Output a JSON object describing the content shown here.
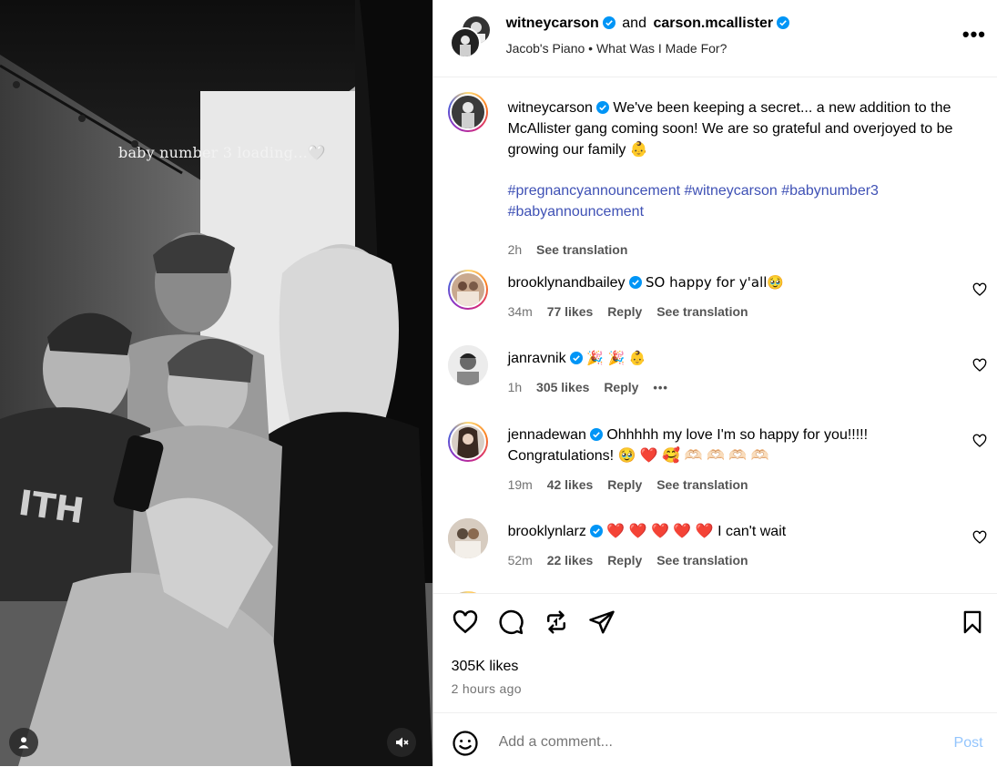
{
  "media": {
    "overlay_text": "baby number 3 loading...🤍"
  },
  "header": {
    "user1": "witneycarson",
    "and_word": "and",
    "user2": "carson.mcallister",
    "audio": "Jacob's Piano • What Was I Made For?",
    "more_label": "•••"
  },
  "caption": {
    "username": "witneycarson",
    "text": "We've been keeping a secret... a new addition to the McAllister gang coming soon! We are so grateful and overjoyed to be growing our family 👶",
    "hashtags_line1": "#pregnancyannouncement #witneycarson #babynumber3",
    "hashtags_line2": "#babyannouncement",
    "time": "2h",
    "see_translation": "See translation"
  },
  "comments": [
    {
      "username": "brooklynandbailey",
      "text": "SO happy for y'all🥹",
      "time": "34m",
      "likes": "77 likes",
      "reply": "Reply",
      "translate": "See translation"
    },
    {
      "username": "janravnik",
      "text": "🎉 🎉 👶",
      "time": "1h",
      "likes": "305 likes",
      "reply": "Reply",
      "more": "•••"
    },
    {
      "username": "jennadewan",
      "text": "Ohhhhh my love I'm so happy for you!!!!! Congratulations! 🥹 ❤️ 🥰 🫶🏻 🫶🏻 🫶🏻 🫶🏻",
      "time": "19m",
      "likes": "42 likes",
      "reply": "Reply",
      "translate": "See translation"
    },
    {
      "username": "brooklynlarz",
      "text": "❤️ ❤️ ❤️ ❤️ ❤️  I can't wait",
      "time": "52m",
      "likes": "22 likes",
      "reply": "Reply",
      "translate": "See translation"
    }
  ],
  "footer": {
    "likes": "305K likes",
    "time": "2 hours ago",
    "comment_placeholder": "Add a comment...",
    "post_label": "Post"
  },
  "colors": {
    "verified": "#0095f6",
    "hashtag": "#3f51b5",
    "post_disabled": "#93c5fd"
  }
}
